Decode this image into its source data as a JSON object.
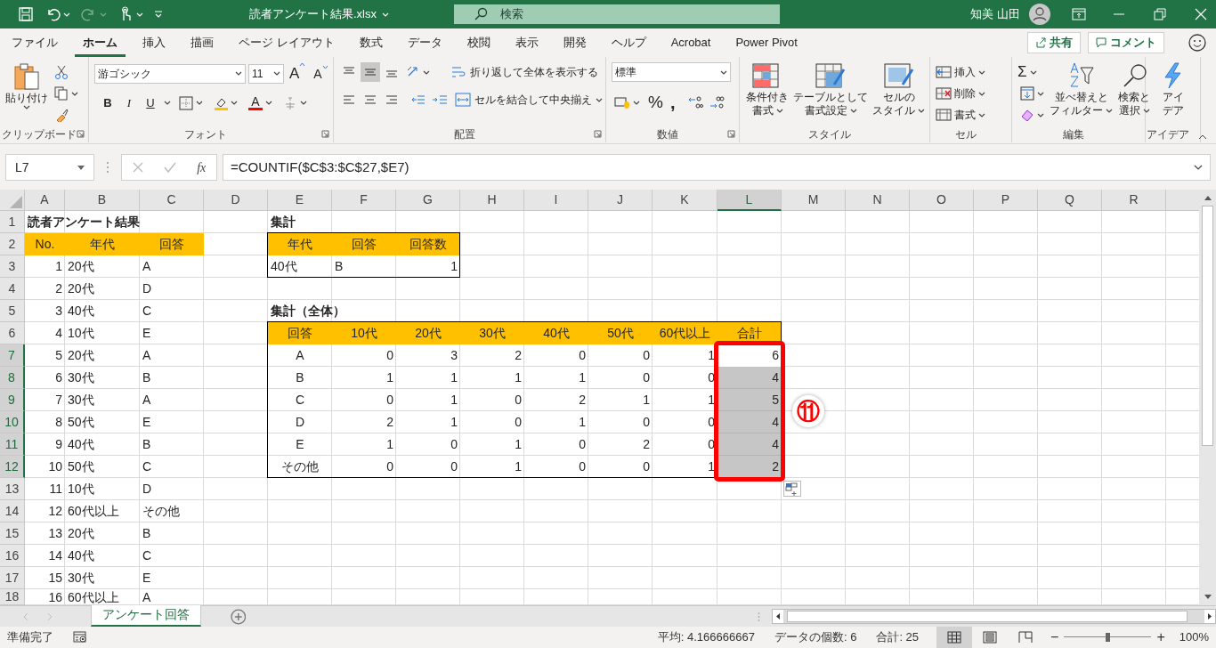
{
  "title_bar": {
    "file_name": "読者アンケート結果.xlsx",
    "search_placeholder": "検索",
    "user_name": "知美 山田"
  },
  "ribbon_tabs": [
    {
      "label": "ファイル",
      "selected": false
    },
    {
      "label": "ホーム",
      "selected": true
    },
    {
      "label": "挿入",
      "selected": false
    },
    {
      "label": "描画",
      "selected": false
    },
    {
      "label": "ページ レイアウト",
      "selected": false
    },
    {
      "label": "数式",
      "selected": false
    },
    {
      "label": "データ",
      "selected": false
    },
    {
      "label": "校閲",
      "selected": false
    },
    {
      "label": "表示",
      "selected": false
    },
    {
      "label": "開発",
      "selected": false
    },
    {
      "label": "ヘルプ",
      "selected": false
    },
    {
      "label": "Acrobat",
      "selected": false
    },
    {
      "label": "Power Pivot",
      "selected": false
    }
  ],
  "share_button": "共有",
  "comment_button": "コメント",
  "ribbon_groups": [
    {
      "kind": "clipboard",
      "label": "クリップボード",
      "launcher": true,
      "paste": "貼り付け"
    },
    {
      "kind": "font",
      "label": "フォント",
      "launcher": true,
      "font_name": "游ゴシック",
      "font_size": "11",
      "grow": "A",
      "shrink": "A",
      "styles": [
        "B",
        "I",
        "U"
      ],
      "font_color": "A"
    },
    {
      "kind": "alignment",
      "label": "配置",
      "launcher": true,
      "vertical_align": [
        {
          "selected": false
        },
        {
          "selected": true
        },
        {
          "selected": false
        }
      ],
      "wrap": "折り返して全体を表示する",
      "merge": "セルを結合して中央揃え"
    },
    {
      "kind": "number",
      "label": "数値",
      "launcher": true,
      "format": "標準",
      "percent": "%",
      "comma": ","
    },
    {
      "kind": "styles",
      "label": "スタイル",
      "launcher": false,
      "buttons": [
        [
          "条件付き",
          "書式"
        ],
        [
          "テーブルとして",
          "書式設定"
        ],
        [
          "セルの",
          "スタイル"
        ]
      ]
    },
    {
      "kind": "cells",
      "label": "セル",
      "launcher": false,
      "buttons": [
        "挿入",
        "削除",
        "書式"
      ]
    },
    {
      "kind": "editing",
      "label": "編集",
      "launcher": false,
      "sum": "Σ",
      "buttons": [
        [
          "並べ替えと",
          "フィルター"
        ],
        [
          "検索と",
          "選択"
        ]
      ]
    },
    {
      "kind": "ideas",
      "label": "アイデア",
      "launcher": false,
      "button": [
        "アイ",
        "デア"
      ]
    }
  ],
  "formula_bar": {
    "name_box": "L7",
    "fx": "fx",
    "formula": "=COUNTIF($C$3:$C$27,$E7)"
  },
  "sheet": {
    "columns": [
      {
        "label": "A",
        "selected": false
      },
      {
        "label": "B",
        "selected": false
      },
      {
        "label": "C",
        "selected": false
      },
      {
        "label": "D",
        "selected": false
      },
      {
        "label": "E",
        "selected": false
      },
      {
        "label": "F",
        "selected": false
      },
      {
        "label": "G",
        "selected": false
      },
      {
        "label": "H",
        "selected": false
      },
      {
        "label": "I",
        "selected": false
      },
      {
        "label": "J",
        "selected": false
      },
      {
        "label": "K",
        "selected": false
      },
      {
        "label": "L",
        "selected": true
      },
      {
        "label": "M",
        "selected": false
      },
      {
        "label": "N",
        "selected": false
      },
      {
        "label": "O",
        "selected": false
      },
      {
        "label": "P",
        "selected": false
      },
      {
        "label": "Q",
        "selected": false
      },
      {
        "label": "R",
        "selected": false
      }
    ],
    "rows": [
      {
        "label": "1",
        "selected": false
      },
      {
        "label": "2",
        "selected": false
      },
      {
        "label": "3",
        "selected": false
      },
      {
        "label": "4",
        "selected": false
      },
      {
        "label": "5",
        "selected": false
      },
      {
        "label": "6",
        "selected": false
      },
      {
        "label": "7",
        "selected": true
      },
      {
        "label": "8",
        "selected": true
      },
      {
        "label": "9",
        "selected": true
      },
      {
        "label": "10",
        "selected": true
      },
      {
        "label": "11",
        "selected": true
      },
      {
        "label": "12",
        "selected": true
      },
      {
        "label": "13",
        "selected": false
      },
      {
        "label": "14",
        "selected": false
      },
      {
        "label": "15",
        "selected": false
      },
      {
        "label": "16",
        "selected": false
      },
      {
        "label": "17",
        "selected": false
      },
      {
        "label": "18",
        "selected": false
      }
    ],
    "titles": [
      "読者アンケート結果",
      "集計",
      "集計（全体）"
    ],
    "tables": [
      {
        "bordered": false,
        "columns": [
          {
            "heading": "No.",
            "kind": "number",
            "selected": false
          },
          {
            "heading": "年代",
            "kind": "text",
            "selected": false
          },
          {
            "heading": "回答",
            "kind": "text",
            "selected": false
          }
        ],
        "rows": [
          [
            "1",
            "20代",
            "A"
          ],
          [
            "2",
            "20代",
            "D"
          ],
          [
            "3",
            "40代",
            "C"
          ],
          [
            "4",
            "10代",
            "E"
          ],
          [
            "5",
            "20代",
            "A"
          ],
          [
            "6",
            "30代",
            "B"
          ],
          [
            "7",
            "30代",
            "A"
          ],
          [
            "8",
            "50代",
            "E"
          ],
          [
            "9",
            "40代",
            "B"
          ],
          [
            "10",
            "50代",
            "C"
          ],
          [
            "11",
            "10代",
            "D"
          ],
          [
            "12",
            "60代以上",
            "その他"
          ],
          [
            "13",
            "20代",
            "B"
          ],
          [
            "14",
            "40代",
            "C"
          ],
          [
            "15",
            "30代",
            "E"
          ],
          [
            "16",
            "60代以上",
            "A"
          ]
        ]
      },
      {
        "bordered": true,
        "columns": [
          {
            "heading": "年代",
            "kind": "text",
            "selected": false
          },
          {
            "heading": "回答",
            "kind": "text",
            "selected": false
          },
          {
            "heading": "回答数",
            "kind": "number",
            "selected": false
          }
        ],
        "rows": [
          [
            "40代",
            "B",
            "1"
          ]
        ]
      },
      {
        "bordered": true,
        "columns": [
          {
            "heading": "回答",
            "kind": "label",
            "selected": false
          },
          {
            "heading": "10代",
            "kind": "number",
            "selected": false
          },
          {
            "heading": "20代",
            "kind": "number",
            "selected": false
          },
          {
            "heading": "30代",
            "kind": "number",
            "selected": false
          },
          {
            "heading": "40代",
            "kind": "number",
            "selected": false
          },
          {
            "heading": "50代",
            "kind": "number",
            "selected": false
          },
          {
            "heading": "60代以上",
            "kind": "number",
            "selected": false
          },
          {
            "heading": "合計",
            "kind": "number",
            "selected": true
          }
        ],
        "rows": [
          [
            "A",
            "0",
            "3",
            "2",
            "0",
            "0",
            "1",
            "6"
          ],
          [
            "B",
            "1",
            "1",
            "1",
            "1",
            "0",
            "0",
            "4"
          ],
          [
            "C",
            "0",
            "1",
            "0",
            "2",
            "1",
            "1",
            "5"
          ],
          [
            "D",
            "2",
            "1",
            "0",
            "1",
            "0",
            "0",
            "4"
          ],
          [
            "E",
            "1",
            "0",
            "1",
            "0",
            "2",
            "0",
            "4"
          ],
          [
            "その他",
            "0",
            "0",
            "1",
            "0",
            "0",
            "1",
            "2"
          ]
        ]
      }
    ],
    "callout": "⑪"
  },
  "sheet_tabs": [
    {
      "label": "アンケート回答",
      "selected": true
    }
  ],
  "status_bar": {
    "ready": "準備完了",
    "stats": [
      "平均: 4.166666667",
      "データの個数: 6",
      "合計: 25"
    ],
    "views": [
      {
        "selected": true
      },
      {
        "selected": false
      },
      {
        "selected": false
      }
    ],
    "zoom_out": "−",
    "zoom_in": "+",
    "zoom": {
      "level": 0.5
    },
    "zoom_text": "100%"
  }
}
